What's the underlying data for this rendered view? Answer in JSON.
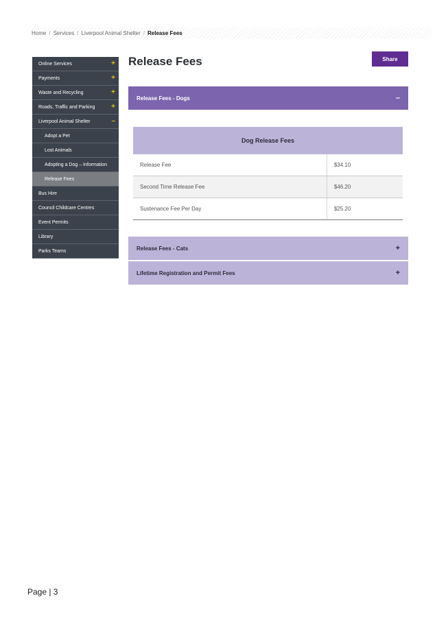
{
  "breadcrumb": {
    "items": [
      "Home",
      "Services",
      "Liverpool Animal Shelter"
    ],
    "current": "Release Fees"
  },
  "sidebar": {
    "items": [
      {
        "label": "Online Services",
        "toggle": "+"
      },
      {
        "label": "Payments",
        "toggle": "+"
      },
      {
        "label": "Waste and Recycling",
        "toggle": "+"
      },
      {
        "label": "Roads, Traffic and Parking",
        "toggle": "+"
      },
      {
        "label": "Liverpool Animal Shelter",
        "toggle": "–"
      },
      {
        "label": "Adopt a Pet"
      },
      {
        "label": "Lost Animals"
      },
      {
        "label": "Adopting a Dog – Information"
      },
      {
        "label": "Release Fees"
      },
      {
        "label": "Bus Hire"
      },
      {
        "label": "Council Childcare Centres"
      },
      {
        "label": "Event Permits"
      },
      {
        "label": "Library"
      },
      {
        "label": "Parks Teams"
      }
    ]
  },
  "page": {
    "title": "Release Fees",
    "share_label": "Share"
  },
  "accordion": [
    {
      "label": "Release Fees - Dogs",
      "sign": "–"
    },
    {
      "label": "Release Fees - Cats",
      "sign": "+"
    },
    {
      "label": "Lifetime Registration and Permit Fees",
      "sign": "+"
    }
  ],
  "dog_table": {
    "heading": "Dog Release Fees",
    "rows": [
      {
        "label": "Release Fee",
        "value": "$34.10"
      },
      {
        "label": "Second Time Release Fee",
        "value": "$46.20"
      },
      {
        "label": "Sustenance Fee Per Day",
        "value": "$25.20"
      }
    ]
  },
  "footer": {
    "page_label": "Page | 3"
  },
  "colors": {
    "sidebar_bg": "#3b424b",
    "sidebar_active": "#7a7e83",
    "toggle_yellow": "#f2c400",
    "share_purple": "#5f2d91",
    "accordion_open": "#7c64ae",
    "accordion_closed": "#bcb3d8"
  }
}
